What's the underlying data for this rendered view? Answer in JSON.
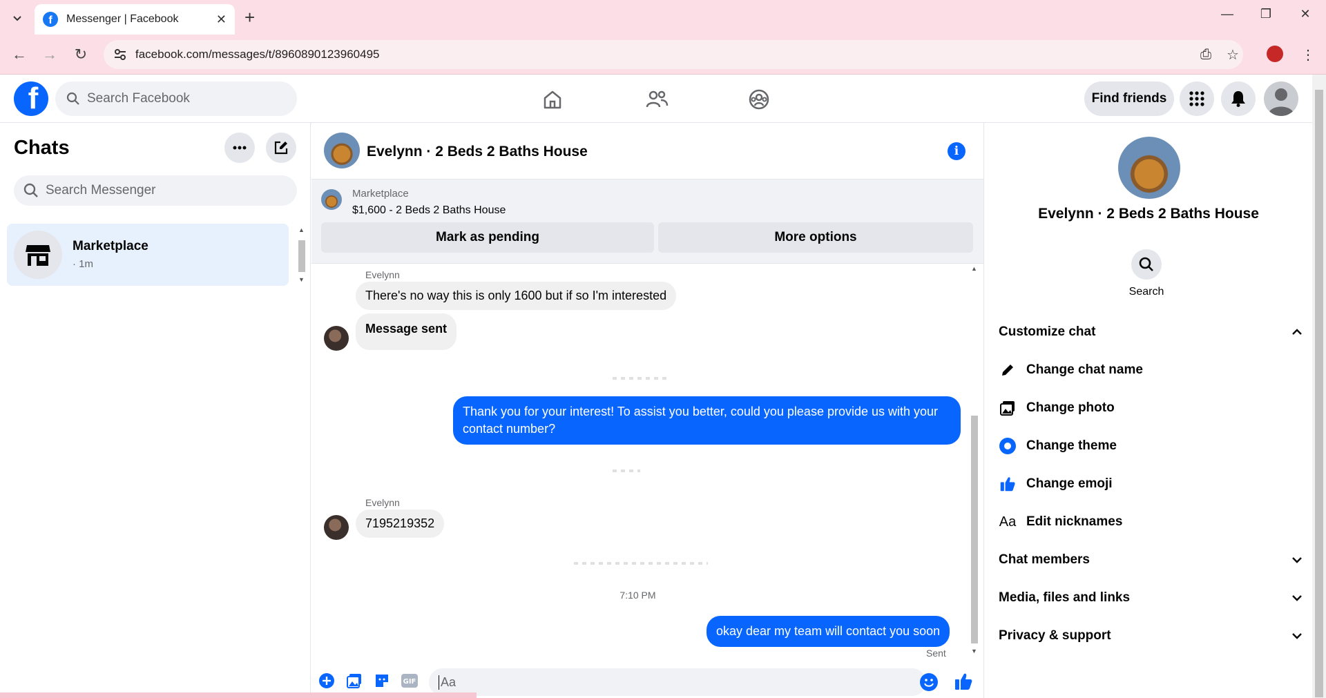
{
  "browser": {
    "tab_title": "Messenger | Facebook",
    "url": "facebook.com/messages/t/8960890123960495"
  },
  "header": {
    "search_placeholder": "Search Facebook",
    "find_friends": "Find friends"
  },
  "sidebar": {
    "title": "Chats",
    "search_placeholder": "Search Messenger",
    "chats": [
      {
        "name": "Marketplace",
        "time": "· 1m"
      }
    ]
  },
  "conversation": {
    "title": "Evelynn · 2 Beds 2 Baths House",
    "marketplace_label": "Marketplace",
    "listing": "$1,600 - 2 Beds 2 Baths House",
    "mark_pending": "Mark as pending",
    "more_options": "More options",
    "messages": [
      {
        "sender": "Evelynn",
        "text": "There's no way this is only 1600 but if so I'm interested",
        "dir": "in"
      },
      {
        "text": "Message sent",
        "dir": "in"
      },
      {
        "text": "Thank you for your interest! To assist you better, could you please provide us with your contact number?",
        "dir": "out"
      },
      {
        "sender": "Evelynn",
        "text": "7195219352",
        "dir": "in"
      },
      {
        "text": "okay dear my team will contact you soon",
        "dir": "out"
      }
    ],
    "timestamp": "7:10 PM",
    "status": "Sent",
    "composer_placeholder": "Aa"
  },
  "right_panel": {
    "title": "Evelynn · 2 Beds 2 Baths House",
    "search_label": "Search",
    "customize": "Customize chat",
    "options": [
      "Change chat name",
      "Change photo",
      "Change theme",
      "Change emoji",
      "Edit nicknames"
    ],
    "chat_members": "Chat members",
    "media": "Media, files and links",
    "privacy": "Privacy & support"
  },
  "colors": {
    "accent": "#0866ff",
    "browser_chrome": "#fcdfe6"
  }
}
